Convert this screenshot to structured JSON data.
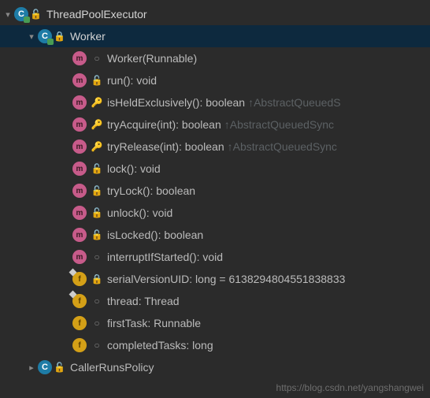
{
  "root": {
    "label": "ThreadPoolExecutor"
  },
  "worker": {
    "label": "Worker"
  },
  "members": [
    {
      "icon": "m",
      "vis": "package",
      "label": "Worker(Runnable)"
    },
    {
      "icon": "m",
      "vis": "public",
      "label": "run(): void"
    },
    {
      "icon": "m",
      "vis": "protected",
      "label": "isHeldExclusively(): boolean",
      "override": "↑AbstractQueuedS"
    },
    {
      "icon": "m",
      "vis": "protected",
      "label": "tryAcquire(int): boolean",
      "override": "↑AbstractQueuedSync"
    },
    {
      "icon": "m",
      "vis": "protected",
      "label": "tryRelease(int): boolean",
      "override": "↑AbstractQueuedSync"
    },
    {
      "icon": "m",
      "vis": "public",
      "label": "lock(): void"
    },
    {
      "icon": "m",
      "vis": "public",
      "label": "tryLock(): boolean"
    },
    {
      "icon": "m",
      "vis": "public",
      "label": "unlock(): void"
    },
    {
      "icon": "m",
      "vis": "public",
      "label": "isLocked(): boolean"
    },
    {
      "icon": "m",
      "vis": "package",
      "label": "interruptIfStarted(): void"
    },
    {
      "icon": "f",
      "static": true,
      "vis": "private",
      "label": "serialVersionUID: long = 6138294804551838833"
    },
    {
      "icon": "f",
      "static": true,
      "vis": "package",
      "label": "thread: Thread"
    },
    {
      "icon": "f",
      "vis": "package",
      "label": "firstTask: Runnable"
    },
    {
      "icon": "f",
      "vis": "package",
      "label": "completedTasks: long"
    }
  ],
  "sibling": {
    "label": "CallerRunsPolicy"
  },
  "watermark": "https://blog.csdn.net/yangshangwei"
}
